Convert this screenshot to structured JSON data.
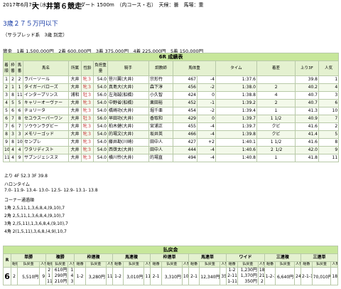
{
  "header": {
    "date": "2017年6月7日（水）",
    "title": "大　井第６競走",
    "info": "ダート 1500m　（内コース・右）　天候：曇　馬場：重"
  },
  "race_class": {
    "name": "3歳２７５万円以下",
    "sub": "（サラブレッド系　3歳 別定）"
  },
  "prize_line": "賞金　1着 1,500,000円　2着 600,000円　3着 375,000円　4着 225,000円　5着 150,000円",
  "results": {
    "title": "6R 成績表",
    "columns": [
      "着順",
      "枠番",
      "馬番",
      "馬名",
      "所属",
      "性齢",
      "負担重量",
      "騎手",
      "調教師",
      "馬体重",
      "タイム",
      "着差",
      "上り3F",
      "人気"
    ],
    "rows": [
      [
        "1",
        "2",
        "2",
        "ラバーソール",
        "大井",
        "牝３",
        "54.0",
        "笹川翼(大井)",
        "宗形竹",
        "467",
        "-4",
        "1:37.6",
        "",
        "39.8",
        "1"
      ],
      [
        "2",
        "1",
        "1",
        "タイガーバローズ",
        "大井",
        "牝３",
        "54.0",
        "真島大(大井)",
        "森下淳",
        "456",
        "-2",
        "1:38.0",
        "２",
        "40.2",
        "4"
      ],
      [
        "3",
        "8",
        "11",
        "インタープリンス",
        "浦和",
        "牡３",
        "56.0",
        "左海誠(船橋)",
        "小久智",
        "424",
        "0",
        "1:38.8",
        "４",
        "40.7",
        "3"
      ],
      [
        "4",
        "5",
        "5",
        "キャリーオーヴァー",
        "大井",
        "牝３",
        "54.0",
        "中野省(船橋)",
        "栗田裕",
        "452",
        "-1",
        "1:39.2",
        "２",
        "40.7",
        "6"
      ],
      [
        "5",
        "6",
        "6",
        "チョリータ",
        "大井",
        "牝３",
        "54.0",
        "橋崎功(大井)",
        "堀千亜",
        "454",
        "-2",
        "1:39.4",
        "１",
        "41.3",
        "10"
      ],
      [
        "6",
        "7",
        "8",
        "セユウスーパーワン",
        "大井",
        "牡３",
        "56.0",
        "早田功(大井)",
        "香取和",
        "429",
        "0",
        "1:39.7",
        "1 1/2",
        "40.9",
        "7"
      ],
      [
        "7",
        "6",
        "7",
        "ソウウンラグビー",
        "大井",
        "牝３",
        "54.0",
        "柏木健(大井)",
        "宮浦正",
        "455",
        "-4",
        "1:39.7",
        "クビ",
        "41.6",
        "2"
      ],
      [
        "8",
        "3",
        "3",
        "メモリーゴッド",
        "大井",
        "牝３",
        "54.0",
        "的場文(大井)",
        "坂井英",
        "466",
        "-4",
        "1:39.8",
        "クビ",
        "41.4",
        "5"
      ],
      [
        "9",
        "8",
        "10",
        "センプレ",
        "大井",
        "牝３",
        "54.0",
        "藤井勘(川崎)",
        "田中人",
        "427",
        "+2",
        "1:40.1",
        "1 1/2",
        "41.6",
        "8"
      ],
      [
        "10",
        "4",
        "4",
        "ワタリディスト",
        "大井",
        "牝３",
        "54.0",
        "西啓太(大井)",
        "田中人",
        "444",
        "-4",
        "1:40.6",
        "２ 1/2",
        "42.0",
        "9"
      ],
      [
        "11",
        "4",
        "9",
        "サプンジェシスヌ",
        "大井",
        "牝３",
        "54.0",
        "横川怜(大井)",
        "的場直",
        "494",
        "-4",
        "1:40.8",
        "１",
        "41.8",
        "11"
      ]
    ]
  },
  "lap_line": "上り 4F 52.3 3F 39.8",
  "halon_title": "ハロンタイム",
  "halon_times": "7.0- 11.9- 13.4- 13.0- 12.5- 12.9- 13.1- 13.8",
  "corner_title": "コーナー通過順",
  "corners": [
    "1角 2,5,11,1,3,6,8,4,(9,10),7",
    "2角 2,5,11,1,3,6,8,4,(9,10),7",
    "3角 2,(5,11),1,3,6,8,4,(9,10),7",
    "4角 2(1,5,11),3,6,8,(4,9),10,7"
  ],
  "payout": {
    "title": "払戻金",
    "r_label": "R",
    "headers": [
      "単勝",
      "複勝",
      "枠連複",
      "馬連複",
      "枠連単",
      "馬連単",
      "ワイド",
      "三連複",
      "三連単"
    ],
    "sub_headers": [
      "組番",
      "払戻金",
      "人気"
    ],
    "race_no": "6",
    "win": {
      "num": "2",
      "pay": "5,510円",
      "pop": "9"
    },
    "place": {
      "nums": [
        "2",
        "1",
        "11"
      ],
      "pays": [
        "610円",
        "290円",
        "210円"
      ],
      "pops": [
        "1",
        "4",
        "3"
      ]
    },
    "bracket_quinella": {
      "num": "1-2",
      "pay": "3,280円",
      "pop": "11"
    },
    "quinella": {
      "num": "1-2",
      "pay": "3,010円",
      "pop": "11"
    },
    "bracket_exacta": {
      "num": "2-1",
      "pay": "3,310円",
      "pop": "10"
    },
    "exacta": {
      "num": "2-1",
      "pay": "12,340円",
      "pop": "35"
    },
    "exacta2": {
      "num": "2-1",
      "pay": "11,610円",
      "pop": "18"
    },
    "wide": {
      "nums": [
        "1-2",
        "2-11",
        "1-11"
      ],
      "pays": [
        "1,230円",
        "1,370円",
        "350円"
      ],
      "pops": [
        "18",
        "21",
        "2"
      ]
    },
    "trio": {
      "num": "1-2-11",
      "pay": "6,640円",
      "pop": "24"
    },
    "trifecta": {
      "num": "2-1-11",
      "pay": "70,010円",
      "pop": "189"
    }
  }
}
